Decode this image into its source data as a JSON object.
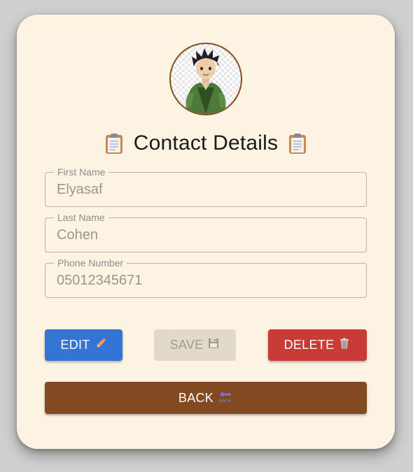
{
  "header": {
    "title": "Contact Details",
    "title_icon_left": "clipboard-icon",
    "title_icon_right": "clipboard-icon",
    "avatar": "avatar-image"
  },
  "form": {
    "first_name": {
      "label": "First Name",
      "value": "Elyasaf"
    },
    "last_name": {
      "label": "Last Name",
      "value": "Cohen"
    },
    "phone": {
      "label": "Phone Number",
      "value": "05012345671"
    }
  },
  "actions": {
    "edit_label": "EDIT",
    "edit_icon": "pencil-icon",
    "save_label": "SAVE",
    "save_icon": "floppy-disk-icon",
    "delete_label": "DELETE",
    "delete_icon": "trash-icon",
    "back_label": "BACK",
    "back_icon": "back-arrow-icon",
    "back_icon_text": "BACK"
  },
  "colors": {
    "card_bg": "#fdf3e3",
    "edit": "#3474d4",
    "save_disabled": "#e1d9ca",
    "delete": "#c93b36",
    "back": "#834921"
  }
}
